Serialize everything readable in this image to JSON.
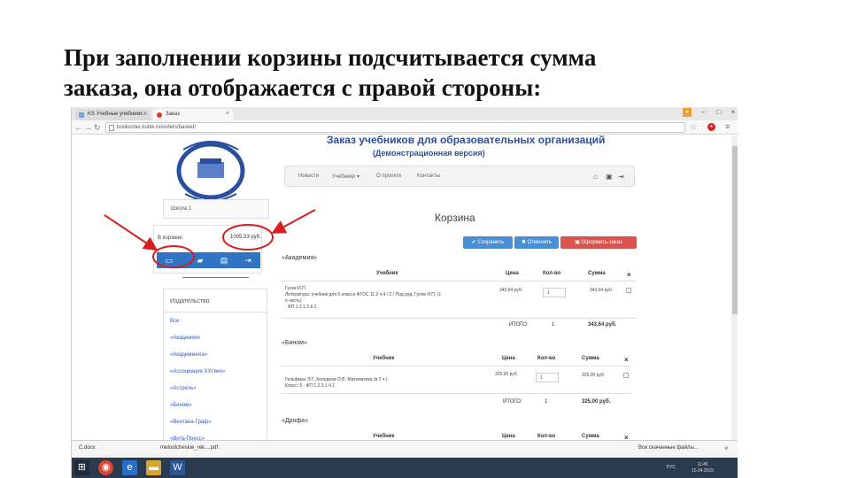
{
  "slide": {
    "title_line1": "При заполнении корзины подсчитывается сумма",
    "title_line2": "заказа, она отображается с правой стороны:"
  },
  "browser": {
    "tabs": [
      {
        "label": "KS Учебные учебники..."
      },
      {
        "label": "Заказ"
      }
    ],
    "url": "bookorder.kubik.ru/orders/basket/"
  },
  "site": {
    "title": "Заказ учебников для образовательных организаций",
    "subtitle": "(Демонстрационная версия)",
    "nav": [
      "Новости",
      "Учебники ▾",
      "О проекте",
      "Контакты"
    ]
  },
  "sidebar": {
    "school_label": "Школа 1",
    "cart_label": "В корзине:",
    "cart_sum": "1005.33 руб.",
    "publishers_title": "Издательство",
    "publishers": [
      "Все",
      "«Академия»",
      "«Академкнига»",
      "«Ассоциация XXI век»",
      "«Астрель»",
      "«Бином»",
      "«Вентана-Граф»",
      "«Вита-Пресс»"
    ]
  },
  "cart": {
    "heading": "Корзина",
    "buttons": {
      "save": "✔ Сохранить",
      "cancel": "✖ Отменить",
      "order": "▣ Оформить заказ"
    },
    "columns": {
      "textbook": "Учебник",
      "price": "Цена",
      "qty": "Кол-во",
      "sum": "Сумма"
    },
    "total_label": "ИТОГО:",
    "sections": [
      {
        "publisher": "«Академия»",
        "item_line1": "Гусев И.П.",
        "item_line2": "Литература: учебник для 5 класса ФГОС 11.2 ч.4 / 2 / Под ред. Гусев И.П. (1",
        "item_line3": "я часть)",
        "item_line4": "ФП 1.2.1.2.6.1",
        "price": "343,64 руб.",
        "qty": "1",
        "sum": "343,64 руб.",
        "total_qty": "1",
        "total_sum": "343,64 руб."
      },
      {
        "publisher": "«Бином»",
        "item_line1": "Гельфман Э.Г.,Холодная О.В. Математика (в 2 ч.)",
        "item_line2": "Класс: 5 · ФП 1.2.3.1.4.1",
        "price": "325,00 руб.",
        "qty": "1",
        "sum": "325,00 руб.",
        "total_qty": "1",
        "total_sum": "325,00 руб."
      },
      {
        "publisher": "«Дрофа»"
      }
    ]
  },
  "downloads": {
    "item1": "С.docx",
    "item2": "metodicheskie_rek....pdf",
    "show_all": "Все скачанные файлы..."
  },
  "taskbar": {
    "lang": "РУС",
    "time": "11:45",
    "date": "15.04.2015"
  },
  "colors": {
    "brand_blue": "#2b4fa0",
    "accent_button": "#4a8fd6",
    "danger_button": "#d9534f",
    "annotation_red": "#d61f1f"
  }
}
